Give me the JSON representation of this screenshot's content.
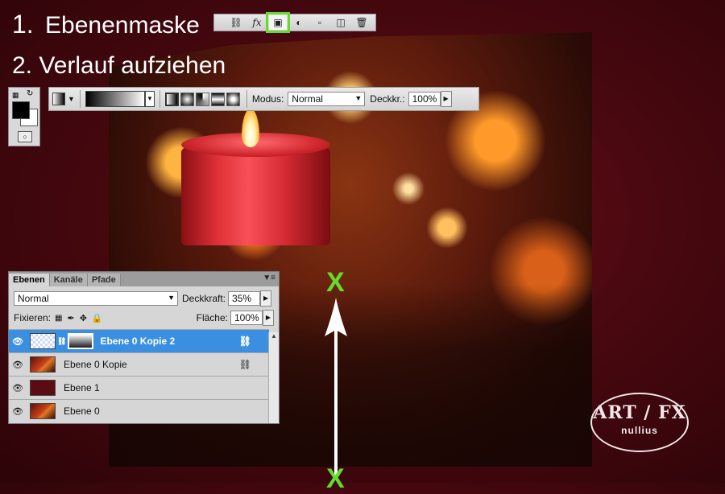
{
  "steps": {
    "step1_number": "1.",
    "step1_label": "Ebenenmaske",
    "step2_label": "2. Verlauf aufziehen"
  },
  "top_toolbar": {
    "icons": [
      "link-icon",
      "fx-icon",
      "layer-mask-icon",
      "adjustment-layer-icon",
      "group-folder-icon",
      "new-layer-icon",
      "trash-icon"
    ],
    "fx_label": "fx",
    "highlight_color": "#63dd2b"
  },
  "options_bar": {
    "modus_label": "Modus:",
    "modus_value": "Normal",
    "deckkr_label": "Deckkr.:",
    "deckkr_value": "100%"
  },
  "layers_panel": {
    "tabs": [
      "Ebenen",
      "Kanäle",
      "Pfade"
    ],
    "blend_mode": "Normal",
    "deckkraft_label": "Deckkraft:",
    "deckkraft_value": "35%",
    "fixieren_label": "Fixieren:",
    "flaeche_label": "Fläche:",
    "flaeche_value": "100%",
    "layers": [
      {
        "name": "Ebene 0 Kopie 2",
        "selected": true
      },
      {
        "name": "Ebene 0 Kopie",
        "selected": false
      },
      {
        "name": "Ebene 1",
        "selected": false
      },
      {
        "name": "Ebene 0",
        "selected": false
      }
    ]
  },
  "markers": {
    "start": "X",
    "end": "X"
  },
  "logo": {
    "main": "ART / FX",
    "sub": "nullius"
  },
  "colors": {
    "background": "#4a0810",
    "selected_layer": "#3a8fe0",
    "marker": "#63dd2b"
  }
}
